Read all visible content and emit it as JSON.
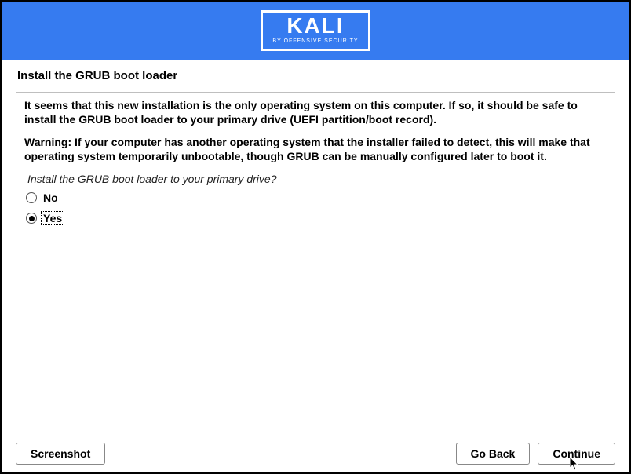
{
  "header": {
    "logo_text": "KALI",
    "logo_subtitle": "BY OFFENSIVE SECURITY"
  },
  "page": {
    "title": "Install the GRUB boot loader"
  },
  "panel": {
    "paragraph1": "It seems that this new installation is the only operating system on this computer. If so, it should be safe to install the GRUB boot loader to your primary drive (UEFI partition/boot record).",
    "paragraph2": "Warning: If your computer has another operating system that the installer failed to detect, this will make that operating system temporarily unbootable, though GRUB can be manually configured later to boot it.",
    "question": "Install the GRUB boot loader to your primary drive?",
    "options": {
      "no": "No",
      "yes": "Yes"
    },
    "selected": "yes"
  },
  "footer": {
    "screenshot_label": "Screenshot",
    "goback_label": "Go Back",
    "continue_label": "Continue"
  }
}
